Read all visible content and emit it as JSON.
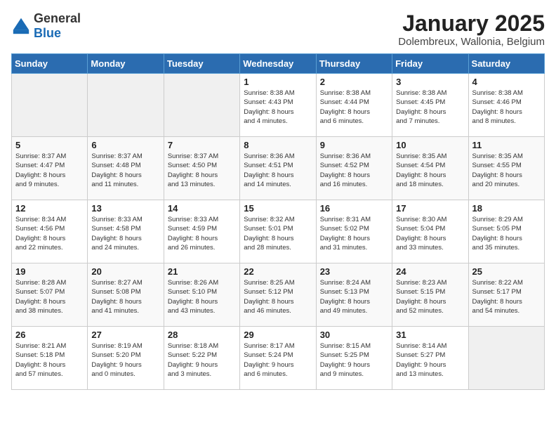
{
  "header": {
    "logo_general": "General",
    "logo_blue": "Blue",
    "title": "January 2025",
    "subtitle": "Dolembreux, Wallonia, Belgium"
  },
  "weekdays": [
    "Sunday",
    "Monday",
    "Tuesday",
    "Wednesday",
    "Thursday",
    "Friday",
    "Saturday"
  ],
  "weeks": [
    [
      {
        "day": "",
        "info": ""
      },
      {
        "day": "",
        "info": ""
      },
      {
        "day": "",
        "info": ""
      },
      {
        "day": "1",
        "info": "Sunrise: 8:38 AM\nSunset: 4:43 PM\nDaylight: 8 hours\nand 4 minutes."
      },
      {
        "day": "2",
        "info": "Sunrise: 8:38 AM\nSunset: 4:44 PM\nDaylight: 8 hours\nand 6 minutes."
      },
      {
        "day": "3",
        "info": "Sunrise: 8:38 AM\nSunset: 4:45 PM\nDaylight: 8 hours\nand 7 minutes."
      },
      {
        "day": "4",
        "info": "Sunrise: 8:38 AM\nSunset: 4:46 PM\nDaylight: 8 hours\nand 8 minutes."
      }
    ],
    [
      {
        "day": "5",
        "info": "Sunrise: 8:37 AM\nSunset: 4:47 PM\nDaylight: 8 hours\nand 9 minutes."
      },
      {
        "day": "6",
        "info": "Sunrise: 8:37 AM\nSunset: 4:48 PM\nDaylight: 8 hours\nand 11 minutes."
      },
      {
        "day": "7",
        "info": "Sunrise: 8:37 AM\nSunset: 4:50 PM\nDaylight: 8 hours\nand 13 minutes."
      },
      {
        "day": "8",
        "info": "Sunrise: 8:36 AM\nSunset: 4:51 PM\nDaylight: 8 hours\nand 14 minutes."
      },
      {
        "day": "9",
        "info": "Sunrise: 8:36 AM\nSunset: 4:52 PM\nDaylight: 8 hours\nand 16 minutes."
      },
      {
        "day": "10",
        "info": "Sunrise: 8:35 AM\nSunset: 4:54 PM\nDaylight: 8 hours\nand 18 minutes."
      },
      {
        "day": "11",
        "info": "Sunrise: 8:35 AM\nSunset: 4:55 PM\nDaylight: 8 hours\nand 20 minutes."
      }
    ],
    [
      {
        "day": "12",
        "info": "Sunrise: 8:34 AM\nSunset: 4:56 PM\nDaylight: 8 hours\nand 22 minutes."
      },
      {
        "day": "13",
        "info": "Sunrise: 8:33 AM\nSunset: 4:58 PM\nDaylight: 8 hours\nand 24 minutes."
      },
      {
        "day": "14",
        "info": "Sunrise: 8:33 AM\nSunset: 4:59 PM\nDaylight: 8 hours\nand 26 minutes."
      },
      {
        "day": "15",
        "info": "Sunrise: 8:32 AM\nSunset: 5:01 PM\nDaylight: 8 hours\nand 28 minutes."
      },
      {
        "day": "16",
        "info": "Sunrise: 8:31 AM\nSunset: 5:02 PM\nDaylight: 8 hours\nand 31 minutes."
      },
      {
        "day": "17",
        "info": "Sunrise: 8:30 AM\nSunset: 5:04 PM\nDaylight: 8 hours\nand 33 minutes."
      },
      {
        "day": "18",
        "info": "Sunrise: 8:29 AM\nSunset: 5:05 PM\nDaylight: 8 hours\nand 35 minutes."
      }
    ],
    [
      {
        "day": "19",
        "info": "Sunrise: 8:28 AM\nSunset: 5:07 PM\nDaylight: 8 hours\nand 38 minutes."
      },
      {
        "day": "20",
        "info": "Sunrise: 8:27 AM\nSunset: 5:08 PM\nDaylight: 8 hours\nand 41 minutes."
      },
      {
        "day": "21",
        "info": "Sunrise: 8:26 AM\nSunset: 5:10 PM\nDaylight: 8 hours\nand 43 minutes."
      },
      {
        "day": "22",
        "info": "Sunrise: 8:25 AM\nSunset: 5:12 PM\nDaylight: 8 hours\nand 46 minutes."
      },
      {
        "day": "23",
        "info": "Sunrise: 8:24 AM\nSunset: 5:13 PM\nDaylight: 8 hours\nand 49 minutes."
      },
      {
        "day": "24",
        "info": "Sunrise: 8:23 AM\nSunset: 5:15 PM\nDaylight: 8 hours\nand 52 minutes."
      },
      {
        "day": "25",
        "info": "Sunrise: 8:22 AM\nSunset: 5:17 PM\nDaylight: 8 hours\nand 54 minutes."
      }
    ],
    [
      {
        "day": "26",
        "info": "Sunrise: 8:21 AM\nSunset: 5:18 PM\nDaylight: 8 hours\nand 57 minutes."
      },
      {
        "day": "27",
        "info": "Sunrise: 8:19 AM\nSunset: 5:20 PM\nDaylight: 9 hours\nand 0 minutes."
      },
      {
        "day": "28",
        "info": "Sunrise: 8:18 AM\nSunset: 5:22 PM\nDaylight: 9 hours\nand 3 minutes."
      },
      {
        "day": "29",
        "info": "Sunrise: 8:17 AM\nSunset: 5:24 PM\nDaylight: 9 hours\nand 6 minutes."
      },
      {
        "day": "30",
        "info": "Sunrise: 8:15 AM\nSunset: 5:25 PM\nDaylight: 9 hours\nand 9 minutes."
      },
      {
        "day": "31",
        "info": "Sunrise: 8:14 AM\nSunset: 5:27 PM\nDaylight: 9 hours\nand 13 minutes."
      },
      {
        "day": "",
        "info": ""
      }
    ]
  ]
}
